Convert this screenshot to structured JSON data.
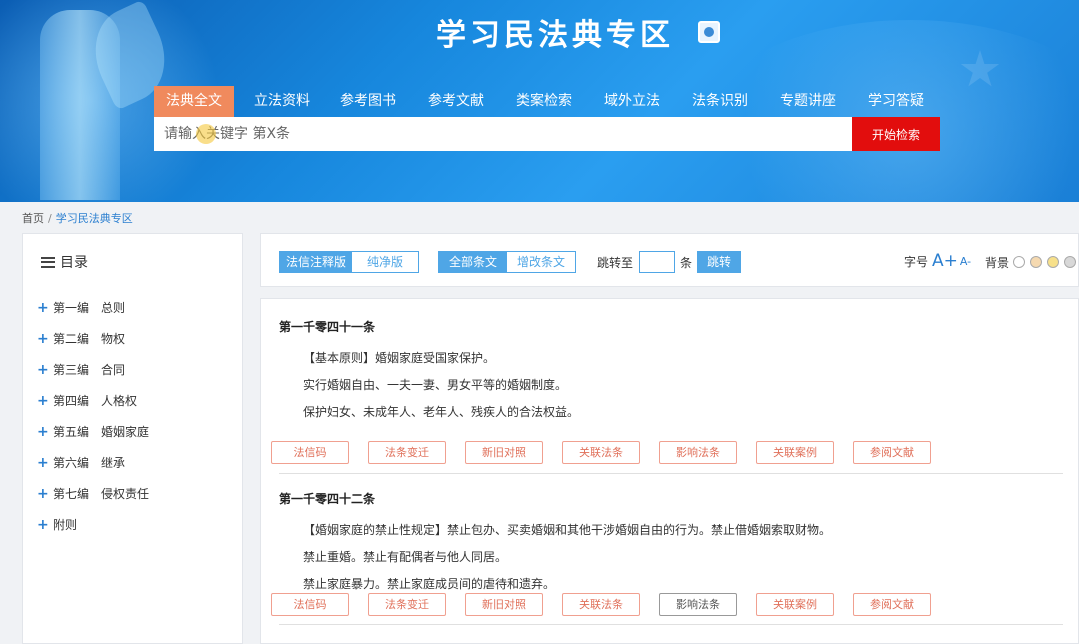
{
  "header": {
    "title": "学习民法典专区",
    "nav": [
      "法典全文",
      "立法资料",
      "参考图书",
      "参考文献",
      "类案检索",
      "域外立法",
      "法条识别",
      "专题讲座",
      "学习答疑"
    ],
    "search_placeholder": "请输入关键字 第X条",
    "search_button": "开始检索"
  },
  "breadcrumb": {
    "home": "首页",
    "sep": "/",
    "current": "学习民法典专区"
  },
  "sidebar": {
    "title": "目录",
    "items": [
      "第一编　总则",
      "第二编　物权",
      "第三编　合同",
      "第四编　人格权",
      "第五编　婚姻家庭",
      "第六编　继承",
      "第七编　侵权责任",
      "附则"
    ]
  },
  "toolbar": {
    "mode_a_on": "法信注释版",
    "mode_a_off": "纯净版",
    "mode_b_on": "全部条文",
    "mode_b_off": "增改条文",
    "jump_prefix": "跳转至",
    "jump_suffix": "条",
    "jump_button": "跳转",
    "font_label": "字号",
    "font_big": "A+",
    "font_small": "A-",
    "bg_label": "背景",
    "bg_colors": [
      "#ffffff",
      "#f5d9b0",
      "#f7e08a",
      "#d8d8d8"
    ]
  },
  "articles": [
    {
      "title": "第一千零四十一条",
      "lines": [
        "【基本原则】婚姻家庭受国家保护。",
        "实行婚姻自由、一夫一妻、男女平等的婚姻制度。",
        "保护妇女、未成年人、老年人、残疾人的合法权益。"
      ],
      "actions": [
        "法信码",
        "法条变迁",
        "新旧对照",
        "关联法条",
        "影响法条",
        "关联案例",
        "参阅文献"
      ]
    },
    {
      "title": "第一千零四十二条",
      "lines": [
        "【婚姻家庭的禁止性规定】禁止包办、买卖婚姻和其他干涉婚姻自由的行为。禁止借婚姻索取财物。",
        "禁止重婚。禁止有配偶者与他人同居。",
        "禁止家庭暴力。禁止家庭成员间的虐待和遗弃。"
      ],
      "actions": [
        "法信码",
        "法条变迁",
        "新旧对照",
        "关联法条",
        "影响法条",
        "关联案例",
        "参阅文献"
      ]
    }
  ],
  "colors": {
    "accent": "#4fa6e6",
    "search_button": "#e20d0d",
    "active_nav": "#f08a5d"
  }
}
